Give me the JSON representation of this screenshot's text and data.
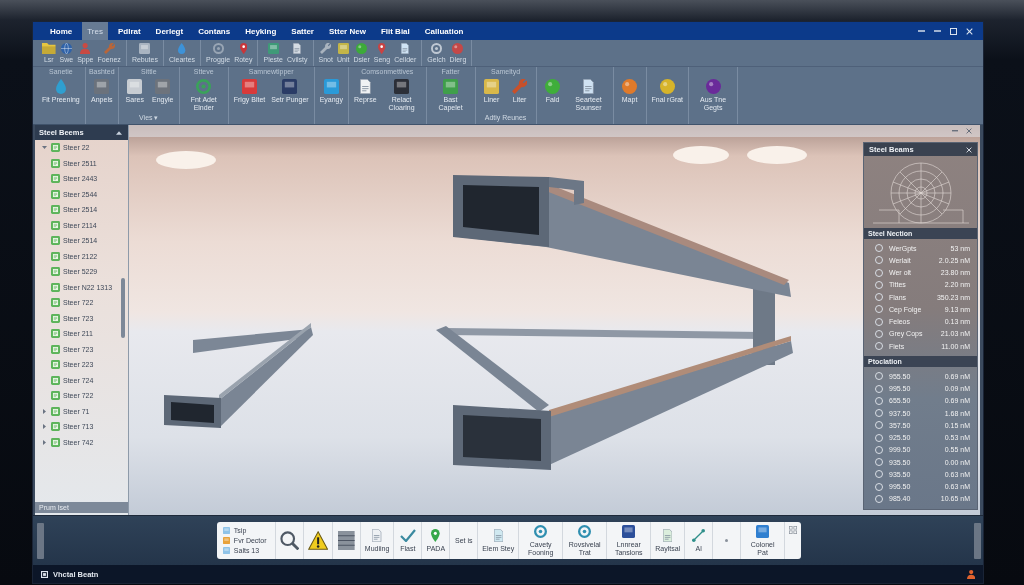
{
  "menu": {
    "tabs": [
      {
        "label": "Home",
        "selected": false
      },
      {
        "label": "Tres",
        "selected": true
      },
      {
        "label": "Pdlrat",
        "selected": false
      },
      {
        "label": "Derlegt",
        "selected": false
      },
      {
        "label": "Contans",
        "selected": false
      },
      {
        "label": "Heyking",
        "selected": false
      },
      {
        "label": "Satter",
        "selected": false
      },
      {
        "label": "Stter New",
        "selected": false
      },
      {
        "label": "Flit Bial",
        "selected": false
      },
      {
        "label": "Calluation",
        "selected": false
      }
    ]
  },
  "ribbon": {
    "quick_groups": [
      {
        "tools": [
          "Lsr",
          "Swe",
          "Sppe",
          "Foenez"
        ]
      },
      {
        "tools": [
          "Rebutes"
        ]
      },
      {
        "tools": [
          "Cleartes"
        ]
      },
      {
        "tools": [
          "Proggie",
          "Rotey"
        ]
      },
      {
        "tools": [
          "Pleste",
          "Cvilsty"
        ]
      },
      {
        "tools": [
          "Snot",
          "Unit",
          "Dsler",
          "Seng",
          "Cellder"
        ]
      },
      {
        "tools": [
          "Gelch",
          "Dlerg"
        ]
      }
    ],
    "groups": [
      {
        "title": "Sanetie",
        "tools": [
          "Fit Preening"
        ]
      },
      {
        "title": "Bashted",
        "tools": [
          "Anpels"
        ]
      },
      {
        "title": "Sittle",
        "tools": [
          "Sares",
          "Engyle"
        ],
        "footer": "Vies ▾"
      },
      {
        "title": "Stteve",
        "tools": [
          "Fnt Adet Elnder"
        ]
      },
      {
        "title": "Samnewtipper",
        "tools": [
          "Frigy Bltet",
          "Setr Punger"
        ]
      },
      {
        "tools": [
          "Eyangy"
        ]
      },
      {
        "title": "Comsonmettives",
        "tools": [
          "Reprse",
          "Relact Cloaring"
        ]
      },
      {
        "title": "Fatter",
        "tools": [
          "Bast Capelet"
        ]
      },
      {
        "title": "Sameltyd",
        "tools": [
          "Liner",
          "Liter"
        ],
        "footer": "Adtiy Reunes"
      },
      {
        "tools": [
          "Fald",
          "Searteet Sounser"
        ]
      },
      {
        "tools": [
          "Mapt"
        ]
      },
      {
        "tools": [
          "Fnal rGrat"
        ]
      },
      {
        "tools": [
          "Aus Tne Gegts"
        ]
      }
    ]
  },
  "tree_panel": {
    "title": "Steel Beems",
    "items": [
      {
        "label": "Steer 22",
        "expanded": true,
        "children": [
          {
            "label": "Steer 2511"
          },
          {
            "label": "Steer 2443"
          },
          {
            "label": "Steer 2544"
          },
          {
            "label": "Steer 2514"
          },
          {
            "label": "Steer 2114"
          },
          {
            "label": "Steer 2514"
          },
          {
            "label": "Steer 2122"
          },
          {
            "label": "Steer 5229"
          },
          {
            "label": "Steer N22 1313"
          },
          {
            "label": "Steer 722"
          },
          {
            "label": "Steer 723"
          },
          {
            "label": "Steer 211"
          },
          {
            "label": "Steer 723"
          },
          {
            "label": "Steer 223"
          },
          {
            "label": "Steer 724"
          },
          {
            "label": "Steer 722"
          }
        ]
      },
      {
        "label": "Steer 71",
        "expanded": false
      },
      {
        "label": "Steer 713",
        "expanded": false
      },
      {
        "label": "Steer 742",
        "expanded": false
      }
    ],
    "footer": "Prum Iset"
  },
  "properties_panel": {
    "title": "Steel Beams",
    "sections": [
      {
        "title": "Steel Nection",
        "rows": [
          {
            "name": "WerGpts",
            "value": "53 nm",
            "selected": false
          },
          {
            "name": "Werlait",
            "value": "2.0.25 nM",
            "selected": false
          },
          {
            "name": "Wer olt",
            "value": "23.80 nm",
            "selected": false
          },
          {
            "name": "Tittes",
            "value": "2.20 nm",
            "selected": false
          },
          {
            "name": "Flans",
            "value": "350.23 nm",
            "selected": false
          },
          {
            "name": "Cep Folge",
            "value": "9.13 nm",
            "selected": false
          },
          {
            "name": "Feleos",
            "value": "0.13 nm",
            "selected": false
          },
          {
            "name": "Grey Cops",
            "value": "21.03 nM",
            "selected": false
          },
          {
            "name": "Fiets",
            "value": "11.00 nM",
            "selected": false
          }
        ]
      },
      {
        "title": "Ptoclation",
        "rows": [
          {
            "name": "955.50",
            "value": "0.69 nM",
            "selected": false
          },
          {
            "name": "995.50",
            "value": "0.09 nM",
            "selected": false
          },
          {
            "name": "655.50",
            "value": "0.69 nM",
            "selected": false
          },
          {
            "name": "937.50",
            "value": "1.68 nM",
            "selected": false
          },
          {
            "name": "357.50",
            "value": "0.15 nM",
            "selected": false
          },
          {
            "name": "925.50",
            "value": "0.53 nM",
            "selected": false
          },
          {
            "name": "999.50",
            "value": "0.55 nM",
            "selected": false
          },
          {
            "name": "935.50",
            "value": "0.00 nM",
            "selected": false
          },
          {
            "name": "935.50",
            "value": "0.63 nM",
            "selected": false
          },
          {
            "name": "995.50",
            "value": "0.63 nM",
            "selected": false
          },
          {
            "name": "985.40",
            "value": "10.65 nM",
            "selected": false
          }
        ]
      }
    ]
  },
  "toolbar": {
    "items": [
      {
        "kind": "legend",
        "rows": [
          "Tsip",
          "Fvr Dector",
          "Salts 13"
        ]
      },
      {
        "kind": "icon"
      },
      {
        "kind": "icon"
      },
      {
        "kind": "icon"
      },
      {
        "kind": "tool",
        "label": "Mudiing"
      },
      {
        "kind": "tool",
        "label": "Flast"
      },
      {
        "kind": "tool",
        "label": "PADA"
      },
      {
        "kind": "text",
        "label": "Set is"
      },
      {
        "kind": "tool",
        "label": "Elem Stey"
      },
      {
        "kind": "tool",
        "label": "Cavety Fooning"
      },
      {
        "kind": "tool",
        "label": "Rovsivelal Trat"
      },
      {
        "kind": "tool",
        "label": "Lnnrear Tanslons"
      },
      {
        "kind": "tool",
        "label": "Rayltsal"
      },
      {
        "kind": "tool",
        "label": "Al"
      },
      {
        "kind": "icon"
      },
      {
        "kind": "tool",
        "label": "Colonel Pat"
      },
      {
        "kind": "mini"
      }
    ]
  },
  "status_bar": {
    "text": "Vhctal Beatn"
  }
}
